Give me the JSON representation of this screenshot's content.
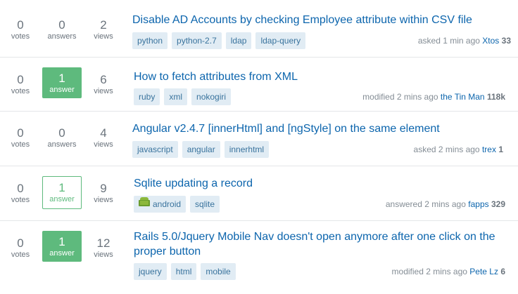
{
  "labels": {
    "votes": "votes",
    "answer_singular": "answer",
    "answer_plural": "answers",
    "views": "views"
  },
  "questions": [
    {
      "votes": "0",
      "answers": "0",
      "answers_label": "answers",
      "views": "2",
      "title": "Disable AD Accounts by checking Employee attribute within CSV file",
      "tags": [
        "python",
        "python-2.7",
        "ldap",
        "ldap-query"
      ],
      "action": "asked 1 min ago",
      "user": "Xtos",
      "reputation": "33"
    },
    {
      "votes": "0",
      "answers": "1",
      "answers_label": "answer",
      "answer_state": "accepted",
      "views": "6",
      "title": "How to fetch attributes from XML",
      "tags": [
        "ruby",
        "xml",
        "nokogiri"
      ],
      "action": "modified 2 mins ago",
      "user": "the Tin Man",
      "reputation": "118k"
    },
    {
      "votes": "0",
      "answers": "0",
      "answers_label": "answers",
      "views": "4",
      "title": "Angular v2.4.7 [innerHtml] and [ngStyle] on the same element",
      "tags": [
        "javascript",
        "angular",
        "innerhtml"
      ],
      "action": "asked 2 mins ago",
      "user": "trex",
      "reputation": "1"
    },
    {
      "votes": "0",
      "answers": "1",
      "answers_label": "answer",
      "answer_state": "answered",
      "views": "9",
      "title": "Sqlite updating a record",
      "tags": [
        "android",
        "sqlite"
      ],
      "tag_icons": {
        "android": "android-icon"
      },
      "action": "answered 2 mins ago",
      "user": "fapps",
      "reputation": "329"
    },
    {
      "votes": "0",
      "answers": "1",
      "answers_label": "answer",
      "answer_state": "accepted",
      "views": "12",
      "title_line1": "Rails 5.0/Jquery Mobile Nav doesn't open anymore after one click on the",
      "title_line2": "proper button",
      "tags": [
        "jquery",
        "html",
        "mobile"
      ],
      "action": "modified 2 mins ago",
      "user": "Pete Lz",
      "reputation": "6"
    }
  ],
  "colors": {
    "link": "#0c65ad",
    "tag_bg": "#e1ecf4",
    "tag_text": "#39739d",
    "answered_green": "#5eba7d",
    "muted": "#6a737c"
  }
}
